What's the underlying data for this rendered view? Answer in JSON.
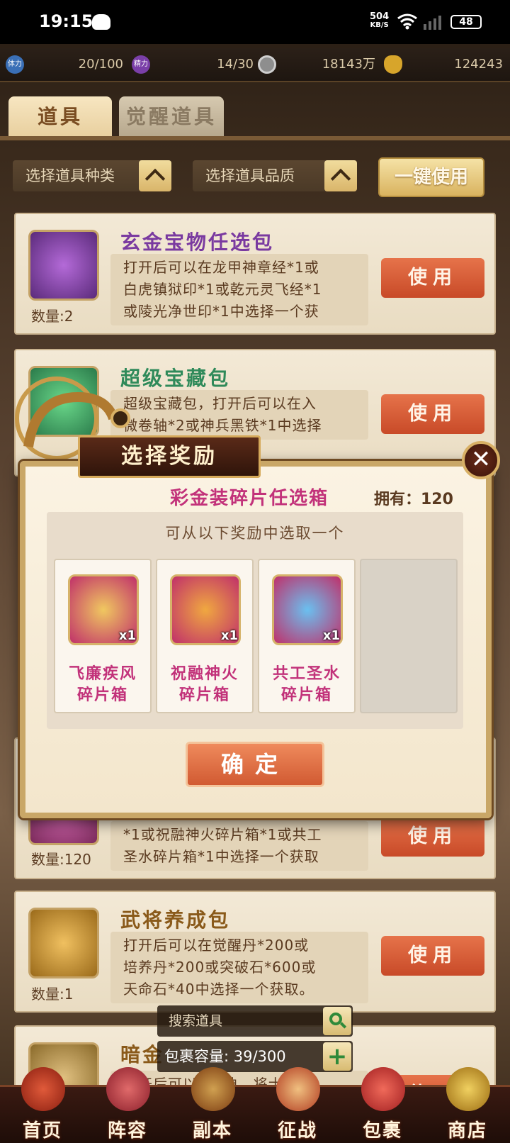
{
  "status": {
    "time": "19:15",
    "net_speed": "504",
    "net_unit": "KB/S",
    "battery": "48"
  },
  "resources": [
    {
      "icon": "stamina-icon",
      "label": "体力",
      "value": "20/100",
      "color": "#3a6fb6"
    },
    {
      "icon": "energy-icon",
      "label": "精力",
      "value": "14/30",
      "color": "#7a3fa8"
    },
    {
      "icon": "coin-icon",
      "label": "",
      "value": "18143万",
      "color": "#9a9a9a"
    },
    {
      "icon": "ingot-icon",
      "label": "",
      "value": "124243",
      "color": "#d7a52b"
    }
  ],
  "tabs": [
    {
      "label": "道具"
    },
    {
      "label": "觉醒道具"
    }
  ],
  "filters": {
    "type_label": "选择道具种类",
    "quality_label": "选择道具品质",
    "one_key_use": "一键使用"
  },
  "items": [
    {
      "name": "玄金宝物任选包",
      "qty": "数量:2",
      "desc": [
        "打开后可以在龙甲神章经*1或",
        "白虎镇狱印*1或乾元灵飞经*1",
        "或陵光净世印*1中选择一个获"
      ],
      "use": "使用",
      "name_color": "#7a3aa0"
    },
    {
      "name": "超级宝藏包",
      "qty": "",
      "desc": [
        "超级宝藏包，打开后可以在入",
        "微卷轴*2或神兵黑铁*1中选择"
      ],
      "use": "使用",
      "name_color": "#2f8a5a"
    },
    {
      "name": "",
      "qty": "数量:120",
      "desc": [
        "*1或祝融神火碎片箱*1或共工",
        "圣水碎片箱*1中选择一个获取"
      ],
      "use": "使用",
      "name_color": "#7a3aa0"
    },
    {
      "name": "武将养成包",
      "qty": "数量:1",
      "desc": [
        "打开后可以在觉醒丹*200或",
        "培养丹*200或突破石*600或",
        "天命石*40中选择一个获取。"
      ],
      "use": "使用",
      "name_color": "#8a5a1a"
    },
    {
      "name": "暗金",
      "qty": "",
      "desc": [
        "打开后可以在..神...将士碎片"
      ],
      "use": "使用",
      "name_color": "#8a5a1a"
    }
  ],
  "search": {
    "placeholder": "搜索道具"
  },
  "capacity": {
    "label": "包裹容量: 39/300",
    "add": "+"
  },
  "nav": [
    {
      "label": "首页",
      "icon": "home-icon"
    },
    {
      "label": "阵容",
      "icon": "lineup-icon"
    },
    {
      "label": "副本",
      "icon": "dungeon-icon"
    },
    {
      "label": "征战",
      "icon": "campaign-icon"
    },
    {
      "label": "包裹",
      "icon": "bag-icon"
    },
    {
      "label": "商店",
      "icon": "shop-icon"
    }
  ],
  "modal": {
    "title": "选择奖励",
    "box_name": "彩金装碎片任选箱",
    "owned": "拥有：120",
    "hint": "可从以下奖励中选取一个",
    "rewards": [
      {
        "name1": "飞廉疾风",
        "name2": "碎片箱",
        "count": "x1",
        "gem": "green"
      },
      {
        "name1": "祝融神火",
        "name2": "碎片箱",
        "count": "x1",
        "gem": "fire"
      },
      {
        "name1": "共工圣水",
        "name2": "碎片箱",
        "count": "x1",
        "gem": "water"
      }
    ],
    "confirm": "确定"
  }
}
